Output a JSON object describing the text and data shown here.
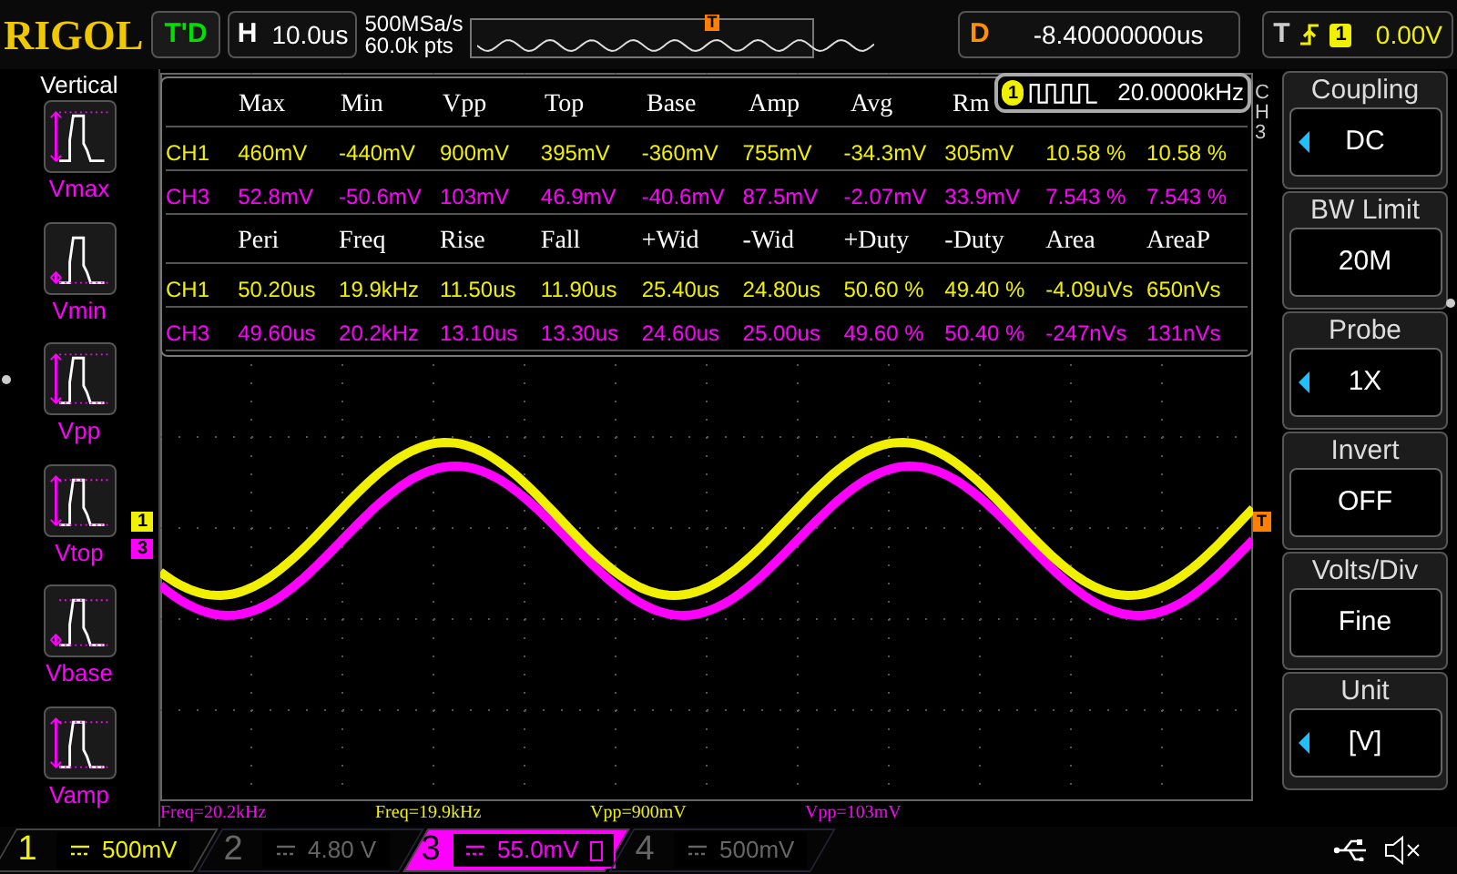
{
  "header": {
    "brand": "RIGOL",
    "run_status": "T'D",
    "horizontal": {
      "label": "H",
      "value": "10.0us"
    },
    "sample_rate": "500MSa/s",
    "memory_depth": "60.0k pts",
    "delay": {
      "label": "D",
      "value": "-8.40000000us"
    },
    "trigger": {
      "label": "T",
      "source": "1",
      "level": "0.00V"
    },
    "trigger_marker": "T"
  },
  "trigger_level_marker": "T",
  "left_menu": {
    "title": "Vertical",
    "items": [
      {
        "label": "Vmax",
        "kind": "max"
      },
      {
        "label": "Vmin",
        "kind": "min"
      },
      {
        "label": "Vpp",
        "kind": "pp"
      },
      {
        "label": "Vtop",
        "kind": "top"
      },
      {
        "label": "Vbase",
        "kind": "base"
      },
      {
        "label": "Vamp",
        "kind": "amp"
      }
    ]
  },
  "measurements": {
    "sections": [
      {
        "headers": [
          "Max",
          "Min",
          "Vpp",
          "Top",
          "Base",
          "Amp",
          "Avg",
          "Rm"
        ],
        "rows": [
          {
            "channel": "CH1",
            "color": "#f0f000",
            "values": [
              "460mV",
              "-440mV",
              "900mV",
              "395mV",
              "-360mV",
              "755mV",
              "-34.3mV",
              "305mV",
              "10.58 %",
              "10.58 %"
            ]
          },
          {
            "channel": "CH3",
            "color": "#ff00ff",
            "values": [
              "52.8mV",
              "-50.6mV",
              "103mV",
              "46.9mV",
              "-40.6mV",
              "87.5mV",
              "-2.07mV",
              "33.9mV",
              "7.543 %",
              "7.543 %"
            ]
          }
        ]
      },
      {
        "headers": [
          "Peri",
          "Freq",
          "Rise",
          "Fall",
          "+Wid",
          "-Wid",
          "+Duty",
          "-Duty",
          "Area",
          "AreaP"
        ],
        "rows": [
          {
            "channel": "CH1",
            "color": "#f0f000",
            "values": [
              "50.20us",
              "19.9kHz",
              "11.50us",
              "11.90us",
              "25.40us",
              "24.80us",
              "50.60 %",
              "49.40 %",
              "-4.09uVs",
              "650nVs"
            ]
          },
          {
            "channel": "CH3",
            "color": "#ff00ff",
            "values": [
              "49.60us",
              "20.2kHz",
              "13.10us",
              "13.30us",
              "24.60us",
              "25.00us",
              "49.60 %",
              "50.40 %",
              "-247nVs",
              "131nVs"
            ]
          }
        ]
      }
    ]
  },
  "counter": {
    "source": "1",
    "value": "20.0000kHz"
  },
  "menu_channel": "CH3",
  "channel_markers": [
    {
      "label": "1",
      "color": "#f0f000"
    },
    {
      "label": "3",
      "color": "#ff00ff"
    }
  ],
  "readouts": [
    {
      "text": "Freq=20.2kHz",
      "color": "#ff00ff"
    },
    {
      "text": "Freq=19.9kHz",
      "color": "#f0f000"
    },
    {
      "text": "Vpp=900mV",
      "color": "#f0f000"
    },
    {
      "text": "Vpp=103mV",
      "color": "#ff00ff"
    }
  ],
  "right_menu": [
    {
      "title": "Coupling",
      "value": "DC",
      "adjustable": true
    },
    {
      "title": "BW Limit",
      "value": "20M",
      "adjustable": false
    },
    {
      "title": "Probe",
      "value": "1X",
      "adjustable": true
    },
    {
      "title": "Invert",
      "value": "OFF",
      "adjustable": false
    },
    {
      "title": "Volts/Div",
      "value": "Fine",
      "adjustable": false
    },
    {
      "title": "Unit",
      "value": "[V]",
      "adjustable": true
    }
  ],
  "channels": [
    {
      "number": "1",
      "scale": "500mV",
      "on": true,
      "selected": false,
      "bw_limit": false,
      "color": "#f0f000"
    },
    {
      "number": "2",
      "scale": "4.80 V",
      "on": false,
      "selected": false,
      "bw_limit": false
    },
    {
      "number": "3",
      "scale": "55.0mV",
      "on": true,
      "selected": true,
      "bw_limit": true,
      "color": "#ff00ff"
    },
    {
      "number": "4",
      "scale": "500mV",
      "on": false,
      "selected": false,
      "bw_limit": false
    }
  ]
}
